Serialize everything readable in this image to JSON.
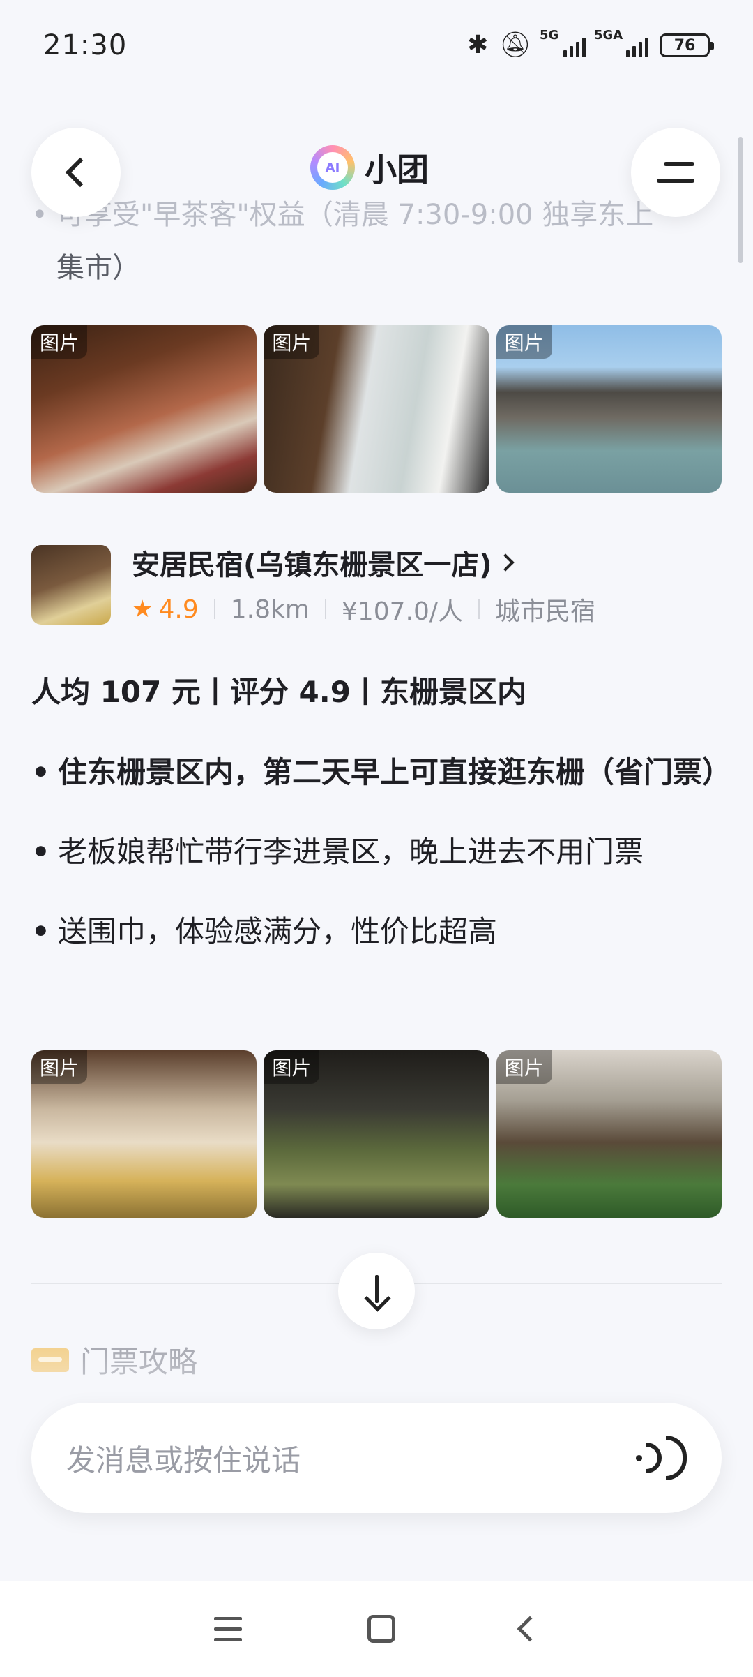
{
  "status_bar": {
    "time": "21:30",
    "network_1": "5G",
    "network_2": "5GA",
    "battery": "76",
    "icons": [
      "bluetooth-icon",
      "mute-bell-icon",
      "signal-icon",
      "battery-icon"
    ]
  },
  "header": {
    "title": "小团",
    "back_icon": "back-chevron-icon",
    "menu_icon": "menu-icon"
  },
  "content": {
    "faded_bullet_line1": "可享受\"早茶客\"权益（清晨 7:30-9:00 独享东上",
    "faded_bullet_line2": "集市）",
    "photo_tag": "图片",
    "shop": {
      "name": "安居民宿(乌镇东栅景区一店)",
      "rating": "4.9",
      "distance": "1.8km",
      "price": "¥107.0/人",
      "category": "城市民宿"
    },
    "summary": "人均 107 元丨评分 4.9丨东栅景区内",
    "bullets": [
      "住东栅景区内，第二天早上可直接逛东栅（省门票）",
      "老板娘帮忙带行李进景区，晚上进去不用门票",
      "送围巾，体验感满分，性价比超高"
    ],
    "next_section_title": "门票攻略"
  },
  "input": {
    "placeholder": "发消息或按住说话"
  },
  "colors": {
    "accent_orange": "#ff8a1f",
    "background": "#f6f7fb"
  }
}
